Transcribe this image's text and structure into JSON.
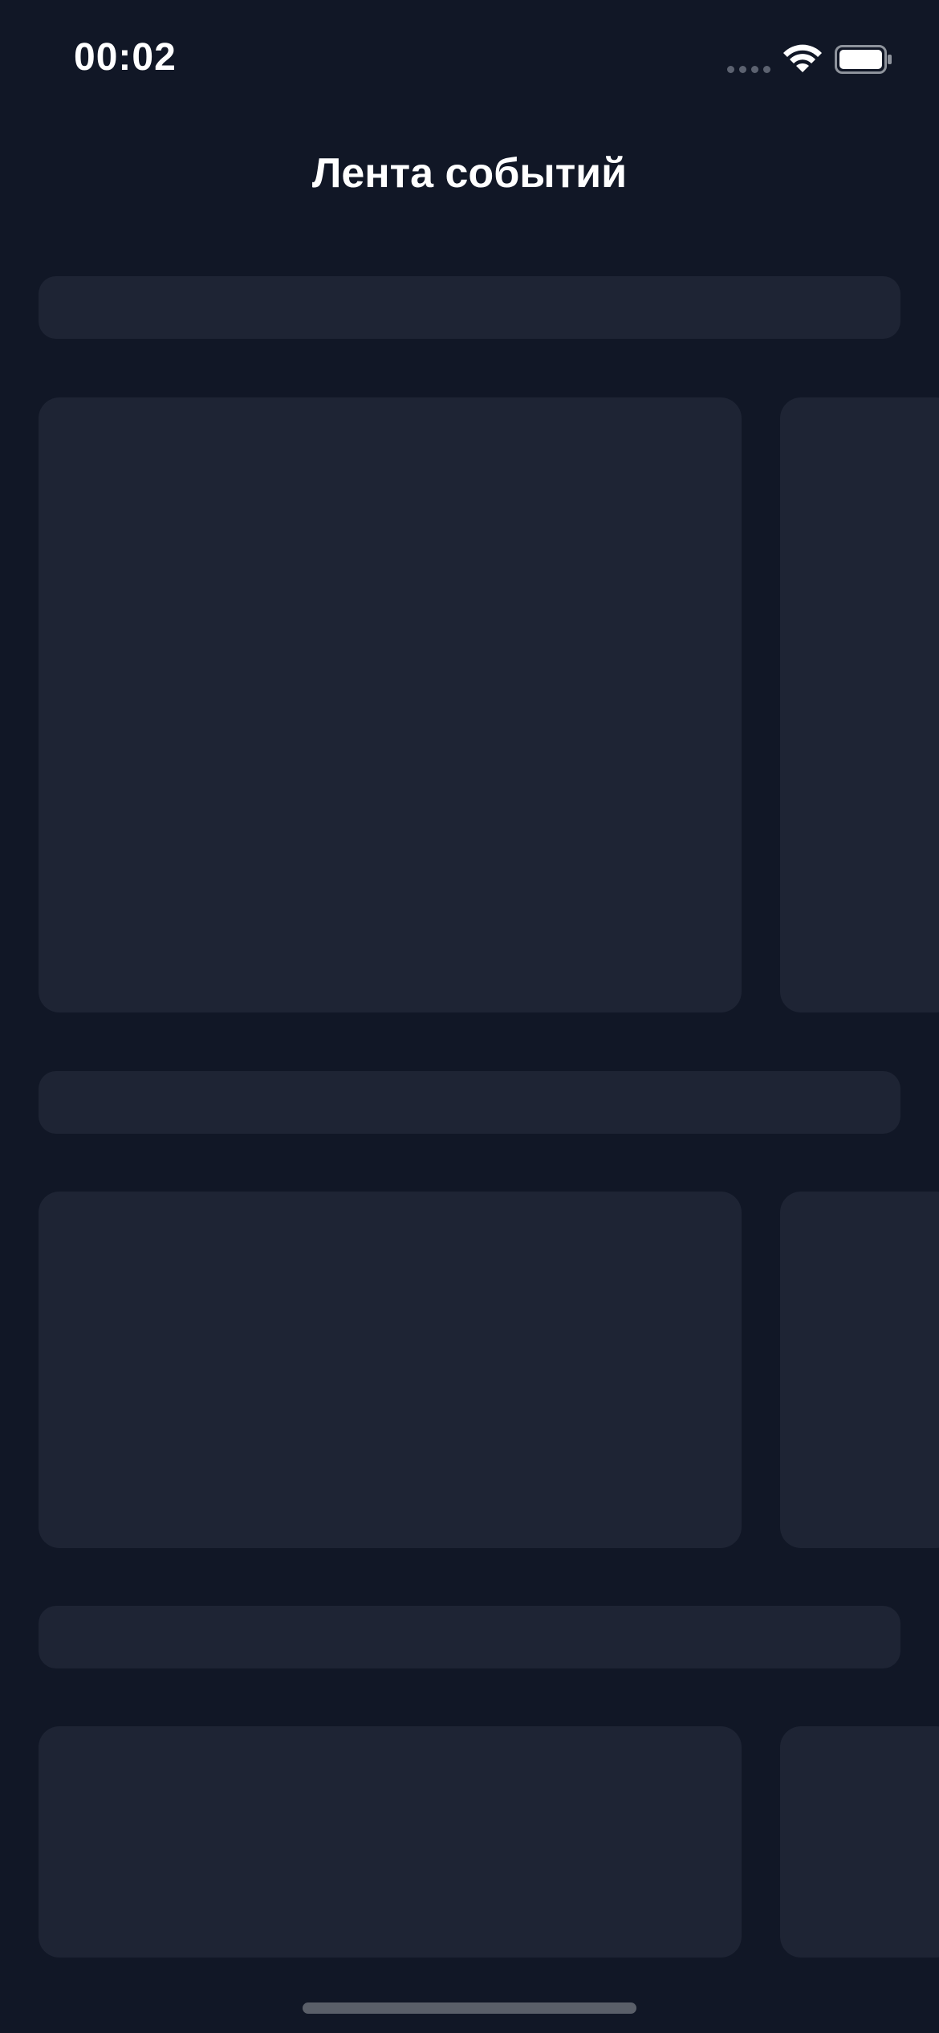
{
  "status_bar": {
    "time": "00:02",
    "icons": [
      "cellular-signal-icon",
      "wifi-icon",
      "battery-icon"
    ]
  },
  "header": {
    "title": "Лента событий"
  },
  "feed": {
    "state": "loading-skeleton",
    "sections": [
      {
        "header_placeholder": true,
        "cards_visible": 2
      },
      {
        "header_placeholder": true,
        "cards_visible": 2
      },
      {
        "header_placeholder": true,
        "cards_visible": 2
      }
    ]
  },
  "colors": {
    "background": "#111726",
    "skeleton": "#1e2434",
    "text": "#ffffff",
    "home_indicator": "#5a5f69"
  }
}
